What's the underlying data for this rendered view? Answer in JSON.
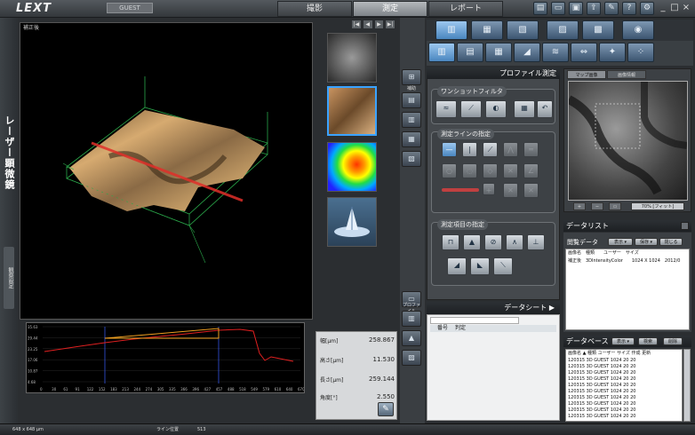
{
  "titlebar": {
    "logo": "LEXT",
    "user": "GUEST",
    "tabs": [
      "撮影",
      "測定",
      "レポート"
    ],
    "active_tab": 1,
    "window_buttons": [
      "_",
      "□",
      "×"
    ]
  },
  "left": {
    "vertical_title": "レーザー顕微鏡",
    "side_tab": "観察設定"
  },
  "image": {
    "title": "補正後"
  },
  "nav": {
    "buttons": [
      "|◀",
      "◀",
      "▶",
      "▶|"
    ]
  },
  "graph": {
    "y_ticks": [
      "35.63",
      "29.44",
      "23.25",
      "17.06",
      "10.87",
      "4.68"
    ],
    "x_ticks": [
      "0",
      "30",
      "61",
      "91",
      "122",
      "152",
      "183",
      "213",
      "244",
      "274",
      "305",
      "335",
      "366",
      "396",
      "427",
      "457",
      "488",
      "518",
      "549",
      "579",
      "610",
      "640",
      "670"
    ]
  },
  "results": {
    "rows": [
      {
        "label": "幅[μm]",
        "value": "258.867"
      },
      {
        "label": "高さ[μm]",
        "value": "11.530"
      },
      {
        "label": "長さ[μm]",
        "value": "259.144"
      },
      {
        "label": "角度[°]",
        "value": "2.550"
      }
    ]
  },
  "mid": {
    "top_label": "補助",
    "bottom_label": "プロファイル"
  },
  "profile": {
    "header": "プロファイル測定",
    "group1": "ワンショットフィルタ",
    "group2": "測定ラインの指定",
    "group3": "測定項目の指定"
  },
  "datasheet": {
    "header": "データシート ▶",
    "col1": "番号",
    "col2": "判定"
  },
  "map": {
    "tab1": "マップ画像",
    "tab2": "画像情報",
    "zoom": "70% [フィット]"
  },
  "datalist": {
    "header": "データリスト",
    "sub": "閲覧データ",
    "btn_show": "表示 ▾",
    "btn_save": "保存 ▾",
    "btn_close": "閉じる",
    "cols": "画像名　種類　　ユーザー　サイズ",
    "row": "補正後　3DIntensityColor　　1024 X 1024　2012/0"
  },
  "database": {
    "header": "データベース",
    "btn_show": "表示 ▾",
    "btn_search": "検索",
    "btn_delete": "削除",
    "cols": "画像名 ▲ 種類 ユーザー サイズ 作成 更新",
    "rows": [
      "120315 3D GUEST 1024 20 20",
      "120315 3D GUEST 1024 20 20",
      "120315 3D GUEST 1024 20 20",
      "120315 3D GUEST 1024 20 20",
      "120315 3D GUEST 1024 20 20",
      "120315 3D GUEST 1024 20 20",
      "120315 3D GUEST 1024 20 20",
      "120315 3D GUEST 1024 20 20",
      "120315 3D GUEST 1024 20 20",
      "120315 3D GUEST 1024 20 20"
    ]
  },
  "status": {
    "size": "648 x 648 μm",
    "line_label": "ライン位置",
    "line_value": "513"
  }
}
